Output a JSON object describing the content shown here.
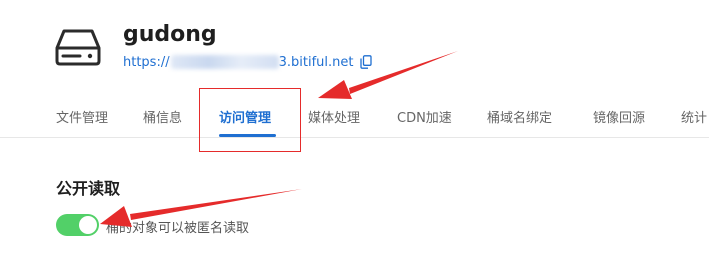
{
  "header": {
    "bucket_name": "gudong",
    "url_prefix": "https://",
    "url_suffix": "3.bitiful.net",
    "icons": {
      "bucket": "hard-drive-icon",
      "copy": "copy-icon"
    }
  },
  "tabs": [
    {
      "label": "文件管理",
      "active": false
    },
    {
      "label": "桶信息",
      "active": false
    },
    {
      "label": "访问管理",
      "active": true
    },
    {
      "label": "媒体处理",
      "active": false
    },
    {
      "label": "CDN加速",
      "active": false
    },
    {
      "label": "桶域名绑定",
      "active": false
    },
    {
      "label": "镜像回源",
      "active": false
    },
    {
      "label": "统计",
      "active": false
    }
  ],
  "public_read": {
    "title": "公开读取",
    "enabled": true,
    "description": "桶的对象可以被匿名读取"
  },
  "colors": {
    "accent": "#1f6fd1",
    "toggle_on": "#52d068",
    "annotation_red": "#e52b2b"
  }
}
